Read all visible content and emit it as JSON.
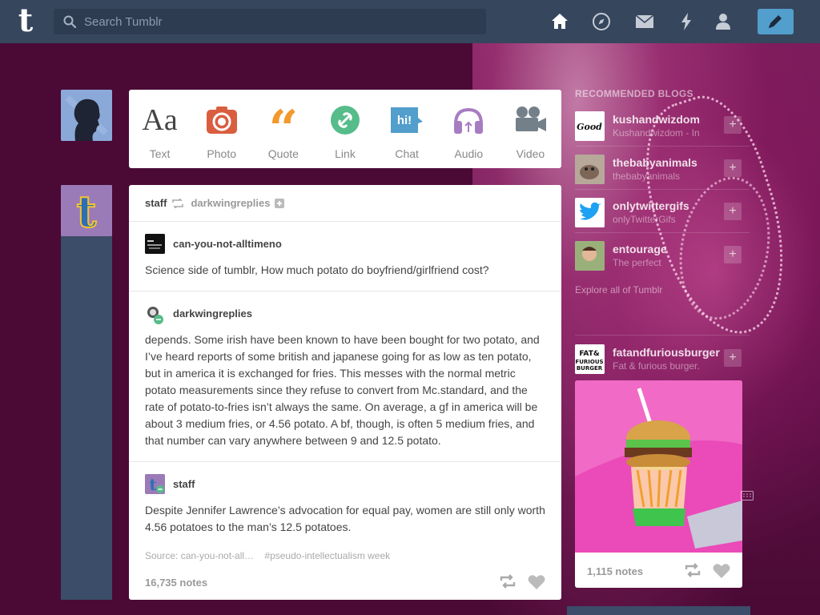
{
  "header": {
    "logo_letter": "t",
    "search_placeholder": "Search Tumblr",
    "nav": [
      "home-icon",
      "explore-compass-icon",
      "inbox-mail-icon",
      "activity-lightning-icon",
      "account-person-icon"
    ],
    "compose_icon": "pencil-icon"
  },
  "post_types": [
    {
      "label": "Text",
      "icon": "Aa",
      "color": "#444444"
    },
    {
      "label": "Photo",
      "icon": "camera-icon",
      "color": "#d95e40"
    },
    {
      "label": "Quote",
      "icon": "quote-icon",
      "color": "#f2992e"
    },
    {
      "label": "Link",
      "icon": "link-icon",
      "color": "#56bc8a"
    },
    {
      "label": "Chat",
      "icon": "hi!",
      "color": "#529ecc"
    },
    {
      "label": "Audio",
      "icon": "headphones-icon",
      "color": "#a77dc2"
    },
    {
      "label": "Video",
      "icon": "video-camera-icon",
      "color": "#748089"
    }
  ],
  "post": {
    "author": "staff",
    "reblogged_from": "darkwingreplies",
    "reblogs": [
      {
        "name": "can-you-not-alltimeno",
        "text": "Science side of tumblr, How much potato do boyfriend/girlfriend cost?"
      },
      {
        "name": "darkwingreplies",
        "text": "depends. Some irish have been known to have been bought for two potato, and I’ve heard reports of some british and japanese going for as low as ten potato, but in america it is exchanged for fries. This messes with the normal metric potato measurements since they refuse to convert from Mc.standard, and the rate of potato-to-fries isn’t always the same. On average, a gf in america will be about 3 medium fries, or 4.56 potato. A bf, though, is often 5 medium fries, and that number can vary anywhere between 9 and 12.5 potato."
      },
      {
        "name": "staff",
        "text": "Despite Jennifer Lawrence’s advocation for equal pay, women are still only worth 4.56 potatoes to the man’s 12.5 potatoes."
      }
    ],
    "source": "Source: can-you-not-all…",
    "tag": "#pseudo-intellectualism week",
    "notes": "16,735 notes"
  },
  "sidebar": {
    "title": "RECOMMENDED BLOGS",
    "blogs": [
      {
        "name": "kushandwizdom",
        "sub": "Kushandwizdom - In"
      },
      {
        "name": "thebabyanimals",
        "sub": "thebabyanimals"
      },
      {
        "name": "onlytwittergifs",
        "sub": "onlyTwitterGifs"
      },
      {
        "name": "entourage",
        "sub": "The perfect"
      }
    ],
    "explore": "Explore all of Tumblr",
    "radar": {
      "name": "fatandfuriousburger",
      "sub": "Fat & furious burger.",
      "notes": "1,115 notes"
    }
  }
}
